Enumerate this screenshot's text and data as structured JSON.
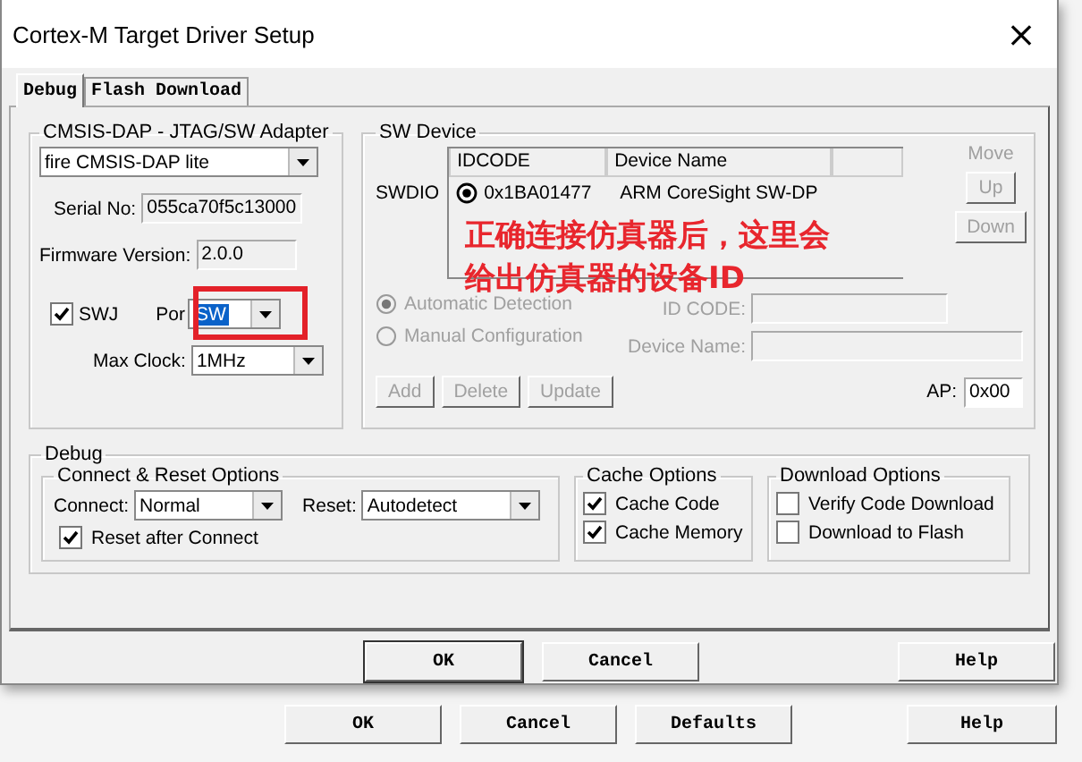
{
  "window": {
    "title": "Cortex-M Target Driver Setup",
    "close": "×"
  },
  "tabs": [
    {
      "label": "Debug",
      "selected": true
    },
    {
      "label": "Flash Download",
      "selected": false
    }
  ],
  "adapter": {
    "title": "CMSIS-DAP - JTAG/SW Adapter",
    "device": "fire CMSIS-DAP lite",
    "serial_label": "Serial No:",
    "serial": "055ca70f5c13000",
    "firmware_label": "Firmware Version:",
    "firmware": "2.0.0",
    "swj": {
      "label": "SWJ",
      "checked": true
    },
    "port_label": "Por",
    "port": "SW",
    "max_clock_label": "Max Clock:",
    "max_clock": "1MHz"
  },
  "sw_device": {
    "title": "SW Device",
    "swdio_label": "SWDIO",
    "columns": [
      "IDCODE",
      "Device Name"
    ],
    "rows": [
      {
        "idcode": "0x1BA01477",
        "device_name": "ARM CoreSight SW-DP",
        "selected": true
      }
    ],
    "move_label": "Move",
    "move_buttons": [
      {
        "label": "Up",
        "disabled": true
      },
      {
        "label": "Down",
        "disabled": true
      }
    ],
    "modes": [
      {
        "label": "Automatic Detection",
        "selected": true,
        "disabled": true
      },
      {
        "label": "Manual Configuration",
        "selected": false,
        "disabled": true
      }
    ],
    "id_code_label": "ID CODE:",
    "device_name_label": "Device Name:",
    "actions": [
      {
        "label": "Add",
        "disabled": true
      },
      {
        "label": "Delete",
        "disabled": true
      },
      {
        "label": "Update",
        "disabled": true
      }
    ],
    "ap_label": "AP:",
    "ap": "0x00"
  },
  "annotation": {
    "lines": [
      "正确连接仿真器后，这里会",
      "给出仿真器的设备ID"
    ]
  },
  "debug": {
    "title": "Debug",
    "connect_reset": {
      "title": "Connect & Reset Options",
      "connect_label": "Connect:",
      "connect": "Normal",
      "reset_label": "Reset:",
      "reset": "Autodetect",
      "reset_after_connect": {
        "label": "Reset after Connect",
        "checked": true
      }
    },
    "cache": {
      "title": "Cache Options",
      "options": [
        {
          "label": "Cache Code",
          "checked": true
        },
        {
          "label": "Cache Memory",
          "checked": true
        }
      ]
    },
    "download": {
      "title": "Download Options",
      "options": [
        {
          "label": "Verify Code Download",
          "checked": false
        },
        {
          "label": "Download to Flash",
          "checked": false
        }
      ]
    }
  },
  "buttons": [
    "OK",
    "Cancel",
    "Help"
  ],
  "background_buttons": [
    "OK",
    "Cancel",
    "Defaults",
    "Help"
  ]
}
